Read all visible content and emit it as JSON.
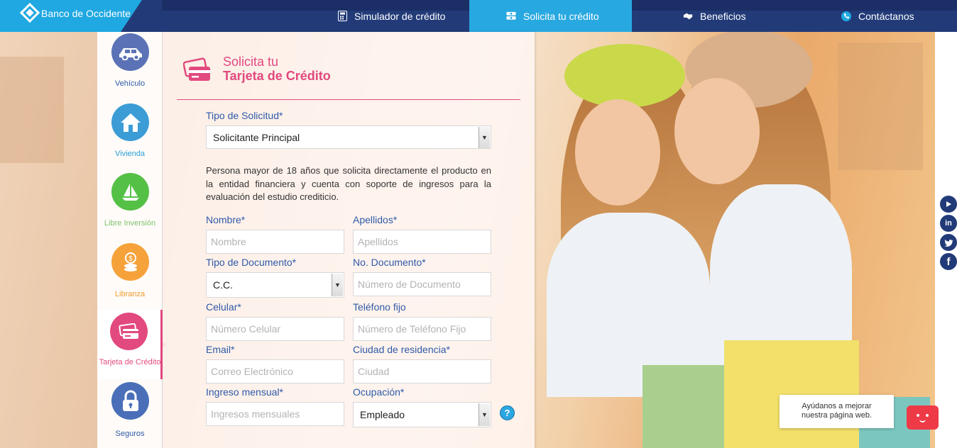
{
  "brand": {
    "name": "Banco de Occidente"
  },
  "nav": [
    {
      "label": "Simulador de crédito",
      "icon": "calculator-icon"
    },
    {
      "label": "Solicita tu crédito",
      "icon": "money-icon",
      "active": true
    },
    {
      "label": "Beneficios",
      "icon": "handshake-icon"
    },
    {
      "label": "Contáctanos",
      "icon": "phone-icon"
    }
  ],
  "sidebar": {
    "items": [
      {
        "label": "Vehículo",
        "color": "#5b73b6",
        "icon": "car-icon"
      },
      {
        "label": "Vivienda",
        "color": "#3b9cd6",
        "icon": "house-icon"
      },
      {
        "label": "Libre Inversión",
        "color": "#55c046",
        "icon": "sailboat-icon"
      },
      {
        "label": "Libranza",
        "color": "#f6a23a",
        "icon": "coins-icon"
      },
      {
        "label": "Tarjeta de Crédito",
        "color": "#e2497f",
        "icon": "credit-card-icon",
        "active": true
      },
      {
        "label": "Seguros",
        "color": "#4a6fb8",
        "icon": "padlock-icon"
      }
    ]
  },
  "form": {
    "title_line1": "Solicita tu",
    "title_line2": "Tarjeta de Crédito",
    "tipo_solicitud": {
      "label": "Tipo de Solicitud*",
      "value": "Solicitante Principal"
    },
    "description": "Persona mayor de 18 años que solicita directamente el producto en la entidad financiera y cuenta con soporte de ingresos para la evaluación del estudio crediticio.",
    "nombre": {
      "label": "Nombre*",
      "placeholder": "Nombre"
    },
    "apellidos": {
      "label": "Apellidos*",
      "placeholder": "Apellidos"
    },
    "tipo_documento": {
      "label": "Tipo de Documento*",
      "value": "C.C."
    },
    "no_documento": {
      "label": "No. Documento*",
      "placeholder": "Número de Documento"
    },
    "celular": {
      "label": "Celular*",
      "placeholder": "Número Celular"
    },
    "telefono": {
      "label": "Teléfono fijo",
      "placeholder": "Número de Teléfono Fijo"
    },
    "email": {
      "label": "Email*",
      "placeholder": "Correo Electrónico"
    },
    "ciudad": {
      "label": "Ciudad de residencia*",
      "placeholder": "Ciudad"
    },
    "ingreso": {
      "label": "Ingreso mensual*",
      "placeholder": "Ingresos mensuales"
    },
    "ocupacion": {
      "label": "Ocupación*",
      "value": "Empleado"
    },
    "help": "?"
  },
  "social": [
    "youtube-icon",
    "linkedin-icon",
    "twitter-icon",
    "facebook-icon"
  ],
  "feedback": {
    "line1": "Ayúdanos a mejorar",
    "line2": "nuestra página web."
  }
}
